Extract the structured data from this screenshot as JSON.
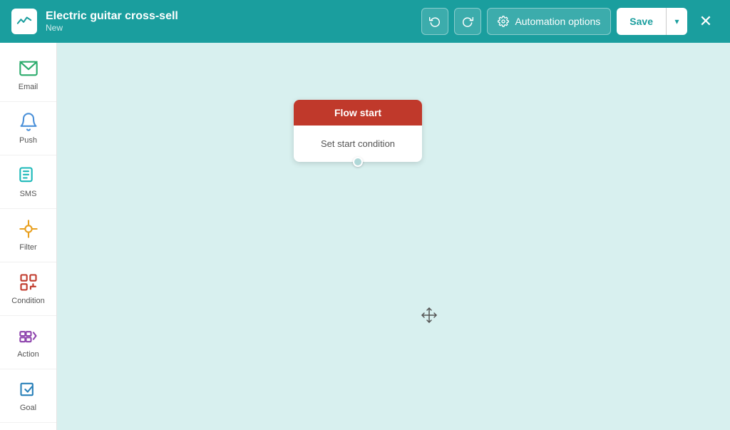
{
  "header": {
    "logo_alt": "Klaviyo logo",
    "title": "Electric guitar cross-sell",
    "subtitle": "New",
    "undo_label": "Undo",
    "redo_label": "Redo",
    "automation_options_label": "Automation options",
    "save_label": "Save",
    "close_label": "Close"
  },
  "sidebar": {
    "items": [
      {
        "id": "email",
        "label": "Email",
        "icon": "email-icon"
      },
      {
        "id": "push",
        "label": "Push",
        "icon": "push-icon"
      },
      {
        "id": "sms",
        "label": "SMS",
        "icon": "sms-icon"
      },
      {
        "id": "filter",
        "label": "Filter",
        "icon": "filter-icon"
      },
      {
        "id": "condition",
        "label": "Condition",
        "icon": "condition-icon"
      },
      {
        "id": "action",
        "label": "Action",
        "icon": "action-icon"
      },
      {
        "id": "goal",
        "label": "Goal",
        "icon": "goal-icon"
      }
    ]
  },
  "canvas": {
    "flow_node": {
      "header": "Flow start",
      "body": "Set start condition"
    }
  }
}
